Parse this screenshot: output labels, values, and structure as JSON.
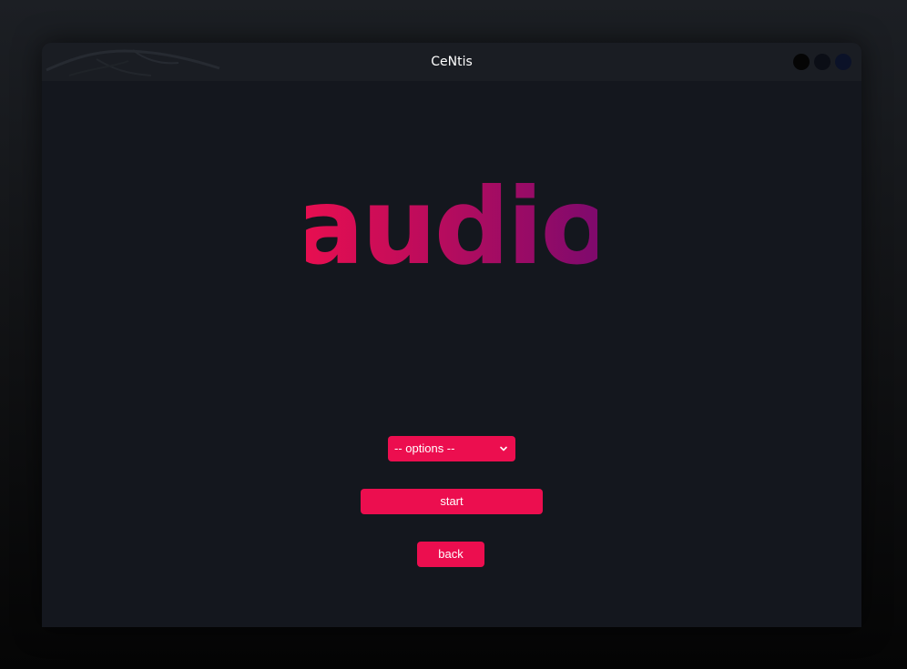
{
  "window": {
    "title": "CeNtis",
    "controls": [
      "minimize-icon",
      "maximize-icon",
      "close-icon"
    ]
  },
  "main": {
    "logo_text": "audio",
    "logo_gradient": [
      "#ec0e4f",
      "#7a0a6e"
    ],
    "options_select": {
      "selected": "-- options --",
      "icon": "chevron-down-icon"
    },
    "start_label": "start",
    "back_label": "back"
  },
  "colors": {
    "accent": "#ec0e4f",
    "window_bg": "#14171e",
    "titlebar_bg": "#1a1d23"
  }
}
